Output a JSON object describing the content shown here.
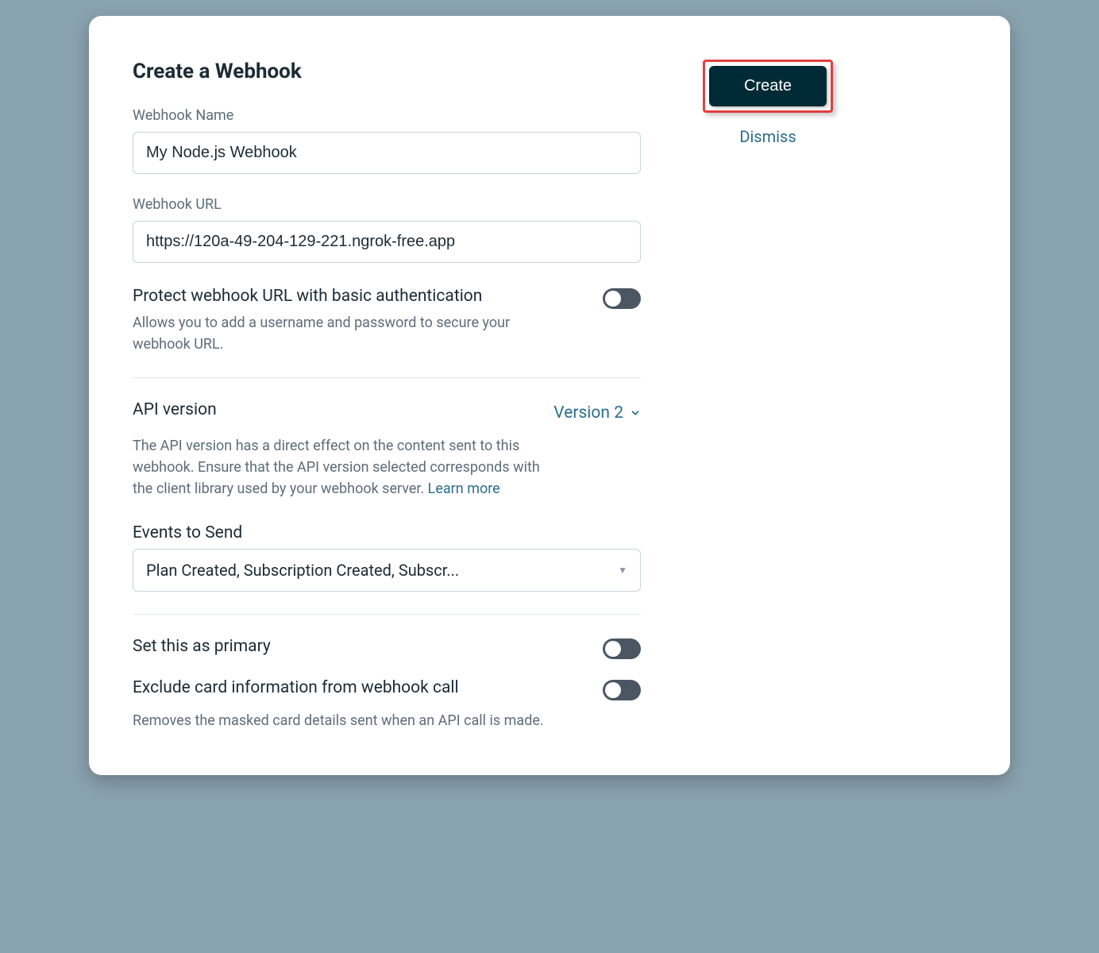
{
  "title": "Create a Webhook",
  "fields": {
    "name_label": "Webhook Name",
    "name_value": "My Node.js Webhook",
    "url_label": "Webhook URL",
    "url_value": "https://120a-49-204-129-221.ngrok-free.app"
  },
  "protect": {
    "title": "Protect webhook URL with basic authentication",
    "desc": "Allows you to add a username and password to secure your webhook URL."
  },
  "api": {
    "title": "API version",
    "version": "Version 2",
    "desc": "The API version has a direct effect on the content sent to this webhook. Ensure that the API version selected corresponds with the client library used by your webhook server. ",
    "learn_more": "Learn more"
  },
  "events": {
    "title": "Events to Send",
    "value": "Plan Created, Subscription Created, Subscr..."
  },
  "primary": {
    "title": "Set this as primary"
  },
  "exclude": {
    "title": "Exclude card information from webhook call",
    "desc": "Removes the masked card details sent when an API call is made."
  },
  "actions": {
    "create": "Create",
    "dismiss": "Dismiss"
  }
}
